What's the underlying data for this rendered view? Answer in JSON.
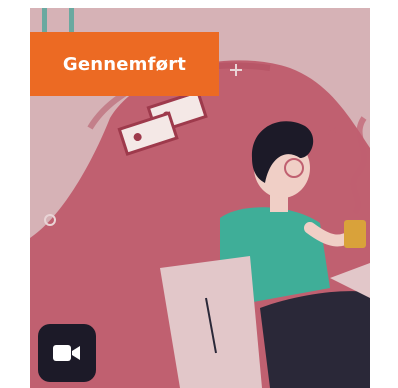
{
  "card": {
    "status_badge": "Gennemført",
    "status_color": "#ec6a23",
    "media_type_icon": "video-camera-icon"
  },
  "colors": {
    "background": "#d6b2b6",
    "accent_shape": "#c06070",
    "shirt": "#3fae98",
    "hair": "#1c1a28",
    "mug": "#d9a23a"
  }
}
